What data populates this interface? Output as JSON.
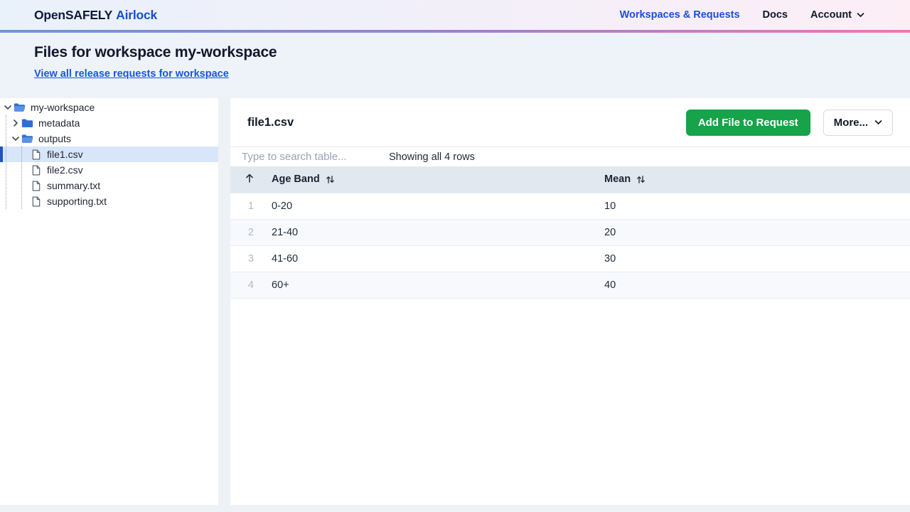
{
  "nav": {
    "brand_primary": "OpenSAFELY",
    "brand_secondary": "Airlock",
    "links": [
      {
        "label": "Workspaces & Requests",
        "icon": null
      },
      {
        "label": "Docs",
        "icon": null
      },
      {
        "label": "Account",
        "icon": "chevron-down-icon"
      }
    ]
  },
  "header": {
    "title": "Files for workspace my-workspace",
    "release_link": "View all release requests for workspace"
  },
  "sidebar": {
    "tree": [
      {
        "label": "my-workspace",
        "depth": 0,
        "icon": "folder-open-icon",
        "chevron": "chevron-down-icon",
        "expanded": true,
        "selected": false
      },
      {
        "label": "metadata",
        "depth": 1,
        "icon": "folder-closed-icon",
        "chevron": "chevron-right-icon",
        "expanded": false,
        "selected": false
      },
      {
        "label": "outputs",
        "depth": 1,
        "icon": "folder-open-icon",
        "chevron": "chevron-down-icon",
        "expanded": true,
        "selected": false
      },
      {
        "label": "file1.csv",
        "depth": 2,
        "icon": "file-icon",
        "chevron": null,
        "selected": true
      },
      {
        "label": "file2.csv",
        "depth": 2,
        "icon": "file-icon",
        "chevron": null,
        "selected": false
      },
      {
        "label": "summary.txt",
        "depth": 2,
        "icon": "file-icon",
        "chevron": null,
        "selected": false
      },
      {
        "label": "supporting.txt",
        "depth": 2,
        "icon": "file-icon",
        "chevron": null,
        "selected": false
      }
    ]
  },
  "main": {
    "file_title": "file1.csv",
    "add_file_button": "Add File to Request",
    "more_button": "More...",
    "search_placeholder": "Type to search table...",
    "showing_text": "Showing all 4 rows",
    "table": {
      "columns": [
        {
          "label": "",
          "icon": "arrow-up-icon",
          "sorted": "asc"
        },
        {
          "label": "Age Band",
          "icon": "sort-icon"
        },
        {
          "label": "Mean",
          "icon": "sort-icon"
        }
      ],
      "rows": [
        {
          "num": "1",
          "age_band": "0-20",
          "mean": "10"
        },
        {
          "num": "2",
          "age_band": "21-40",
          "mean": "20"
        },
        {
          "num": "3",
          "age_band": "41-60",
          "mean": "30"
        },
        {
          "num": "4",
          "age_band": "60+",
          "mean": "40"
        }
      ]
    }
  },
  "colors": {
    "brand_navy": "#0e1b3c",
    "accent_blue": "#1d4ed8",
    "green_button": "#16a34a",
    "tree_selected_bg": "#d8e6f9",
    "tree_selected_bar": "#2053c5",
    "table_header_bg": "#e1e8f0",
    "nav_border_gradient": [
      "#6c98d9",
      "#9f7fd1",
      "#ed79b3"
    ]
  }
}
